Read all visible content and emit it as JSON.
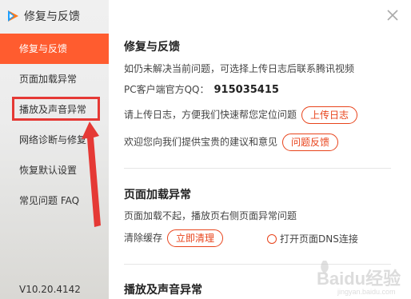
{
  "app": {
    "title": "修复与反馈",
    "logo_icon": "tencent-video-logo"
  },
  "sidebar": {
    "items": [
      {
        "label": "修复与反馈",
        "active": true
      },
      {
        "label": "页面加载异常",
        "active": false
      },
      {
        "label": "播放及声音异常",
        "active": false
      },
      {
        "label": "网络诊断与修复",
        "active": false
      },
      {
        "label": "恢复默认设置",
        "active": false
      },
      {
        "label": "常见问题 FAQ",
        "active": false
      }
    ],
    "version": "V10.20.4142"
  },
  "sections": {
    "repair": {
      "title": "修复与反馈",
      "desc": "如仍未解决当前问题，可选择上传日志后联系腾讯视频",
      "qq_label": "PC客户端官方QQ：",
      "qq_number": "915035415",
      "upload_text": "请上传日志，方便我们快速帮您定位问题",
      "upload_button": "上传日志",
      "feedback_text": "欢迎您向我们提供宝贵的建议和意见",
      "feedback_button": "问题反馈"
    },
    "page_load": {
      "title": "页面加载异常",
      "desc": "页面加载不起，播放页右侧页面异常问题",
      "clear_label": "清除缓存",
      "clear_button": "立即清理",
      "dns_label": "打开页面DNS连接"
    },
    "playback": {
      "title": "播放及声音异常"
    }
  },
  "watermark": {
    "text": "Baidu经验",
    "sub": "jingyan.baidu.com"
  },
  "colors": {
    "accent": "#ff5c2f",
    "button_text": "#e8431b",
    "annotation": "#e53935"
  }
}
